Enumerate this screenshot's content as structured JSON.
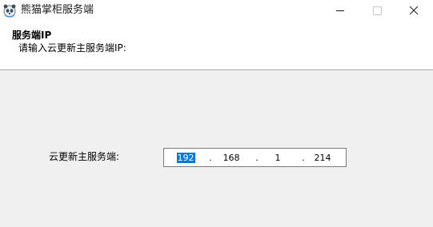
{
  "window": {
    "title": "熊猫掌柜服务端",
    "icon": "panda-app-icon"
  },
  "controls": {
    "minimize_icon": "minimize-icon",
    "maximize_icon": "maximize-icon",
    "close_icon": "close-icon"
  },
  "header": {
    "title": "服务端IP",
    "subtitle": "请输入云更新主服务端IP:"
  },
  "form": {
    "label": "云更新主服务端:",
    "ip": {
      "octet1": "192",
      "octet2": "168",
      "octet3": "1",
      "octet4": "214",
      "separator": "."
    }
  },
  "colors": {
    "selection": "#0078d7",
    "background": "#f0f0f0"
  }
}
